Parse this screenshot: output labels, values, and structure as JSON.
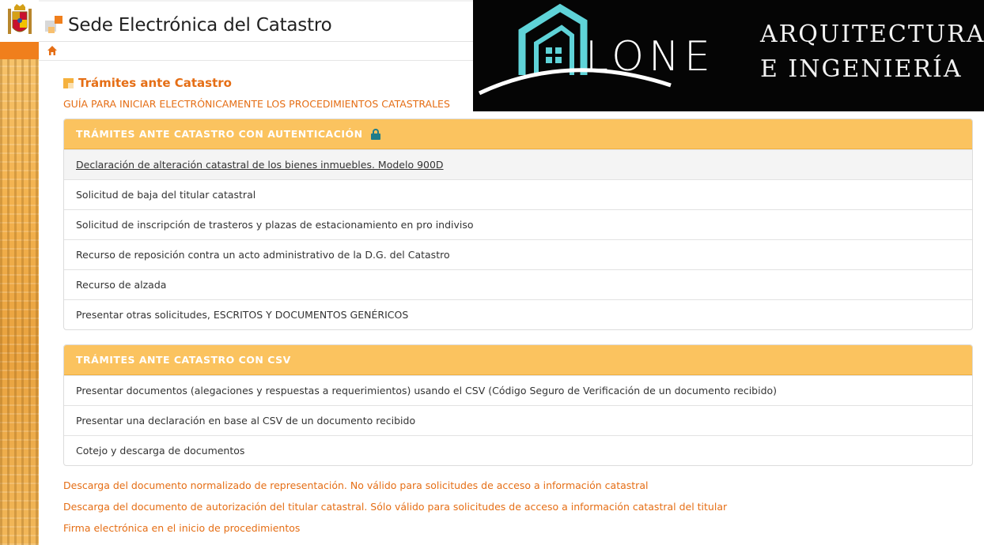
{
  "header": {
    "site_title": "Sede Electrónica del Catastro"
  },
  "watermark": {
    "brand": "LONE",
    "line1": "ARQUITECTURA",
    "line2": "E INGENIERÍA"
  },
  "content": {
    "section_title": "Trámites ante Catastro",
    "guide_link": "GUÍA PARA INICIAR ELECTRÓNICAMENTE LOS PROCEDIMIENTOS CATASTRALES",
    "panel_auth": {
      "title": "TRÁMITES ANTE CATASTRO CON AUTENTICACIÓN",
      "items": [
        "Declaración de alteración catastral de los bienes inmuebles. Modelo 900D",
        "Solicitud de baja del titular catastral",
        "Solicitud de inscripción de trasteros y plazas de estacionamiento en pro indiviso",
        "Recurso de reposición contra un acto administrativo de la D.G. del Catastro",
        "Recurso de alzada",
        "Presentar otras solicitudes, ESCRITOS Y DOCUMENTOS GENÉRICOS"
      ]
    },
    "panel_csv": {
      "title": "TRÁMITES ANTE CATASTRO CON CSV",
      "items": [
        "Presentar documentos (alegaciones y respuestas a requerimientos) usando el CSV (Código Seguro de Verificación de un documento recibido)",
        "Presentar una declaración en base al CSV de un documento recibido",
        "Cotejo y descarga de documentos"
      ]
    },
    "footer_links": [
      "Descarga del documento normalizado de representación. No válido para solicitudes de acceso a información catastral",
      "Descarga del documento de autorización del titular catastral. Sólo válido para solicitudes de acceso a información catastral del titular",
      "Firma electrónica en el inicio de procedimientos"
    ]
  },
  "colors": {
    "accent": "#e56e15",
    "panel_header": "#fbc35f",
    "lock": "#1d7c8b"
  }
}
